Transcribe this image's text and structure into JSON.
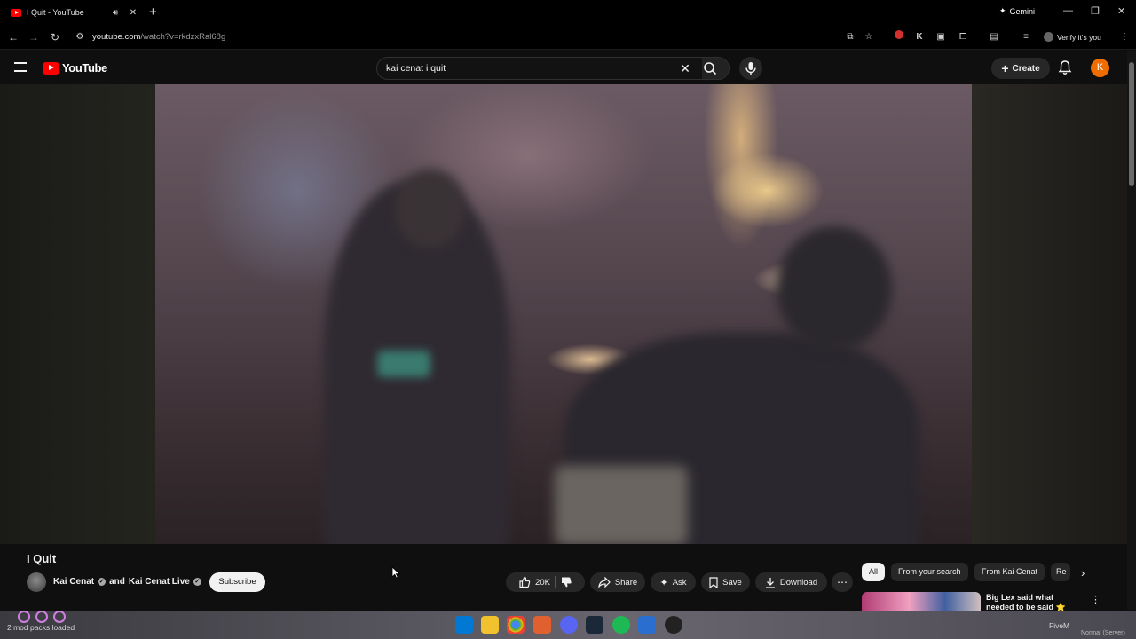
{
  "browser": {
    "tab_title": "I Quit - YouTube",
    "address_domain": "youtube.com",
    "address_path": "/watch?v=rkdzxRal68g",
    "gemini_label": "Gemini",
    "profile_label": "Verify it's you"
  },
  "youtube": {
    "logo_text": "YouTube",
    "search_query": "kai cenat i quit",
    "create_label": "Create",
    "avatar_letter": "K"
  },
  "video": {
    "title": "I Quit",
    "channel_primary": "Kai Cenat",
    "channel_connector": "and",
    "channel_secondary": "Kai Cenat Live",
    "subscribe_label": "Subscribe",
    "like_count": "20K",
    "share_label": "Share",
    "ask_label": "Ask",
    "save_label": "Save",
    "download_label": "Download"
  },
  "chips": [
    "All",
    "From your search",
    "From Kai Cenat",
    "Re"
  ],
  "recommendation": {
    "title": "Big Lex said what needed to be said ⭐ Truth or"
  },
  "taskbar": {
    "left_status": "2 mod packs loaded",
    "right_app_label": "FiveM",
    "right_app_extra": "Normal (Server)"
  },
  "colors": {
    "youtube_red": "#ff0000",
    "background": "#0f0f0f",
    "avatar": "#ef6c00"
  }
}
